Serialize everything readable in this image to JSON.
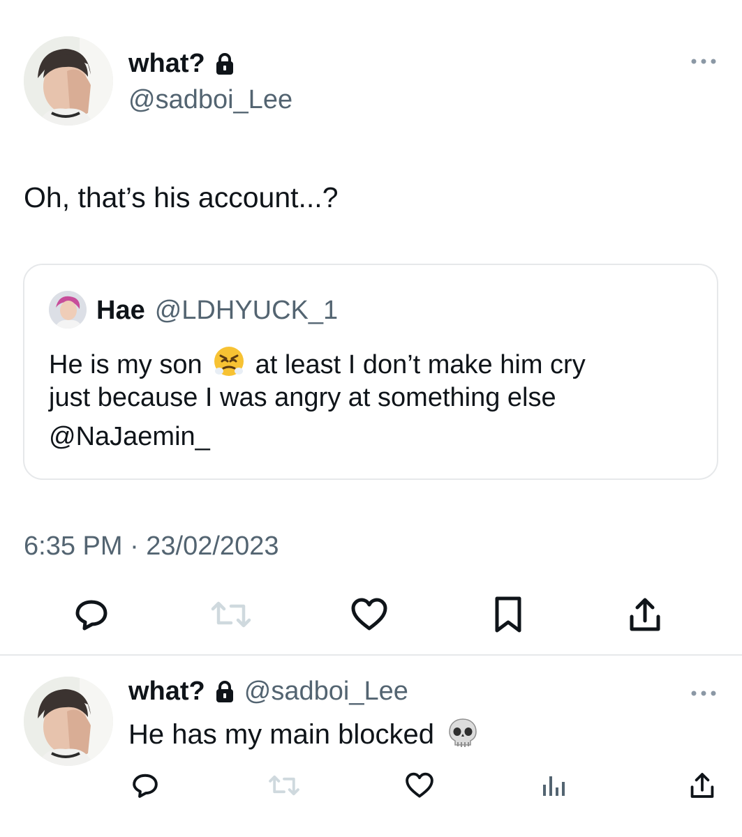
{
  "main_tweet": {
    "display_name": "what?",
    "lock_icon": "lock-icon",
    "handle": "@sadboi_Lee",
    "more_icon": "more-dots-icon",
    "text": "Oh, that’s his account...?",
    "quote": {
      "display_name": "Hae",
      "handle": "@LDHYUCK_1",
      "line1_before": "He is my son",
      "line1_emoji": "😤",
      "line1_after": "at least I don’t make him cry",
      "line2": "just because I was angry at something else",
      "line3": "@NaJaemin_"
    },
    "timestamp": "6:35 PM · 23/02/2023",
    "actions": [
      "reply-icon",
      "retweet-icon",
      "like-icon",
      "bookmark-icon",
      "share-icon"
    ]
  },
  "reply_tweet": {
    "display_name": "what?",
    "handle": "@sadboi_Lee",
    "text": "He has my main blocked",
    "emoji": "💀",
    "actions": [
      "reply-icon",
      "retweet-icon",
      "like-icon",
      "views-icon",
      "share-icon"
    ]
  },
  "colors": {
    "text": "#0f1419",
    "secondary": "#536471",
    "border": "#e6e8ea",
    "retweet_disabled": "#cfd9de"
  }
}
